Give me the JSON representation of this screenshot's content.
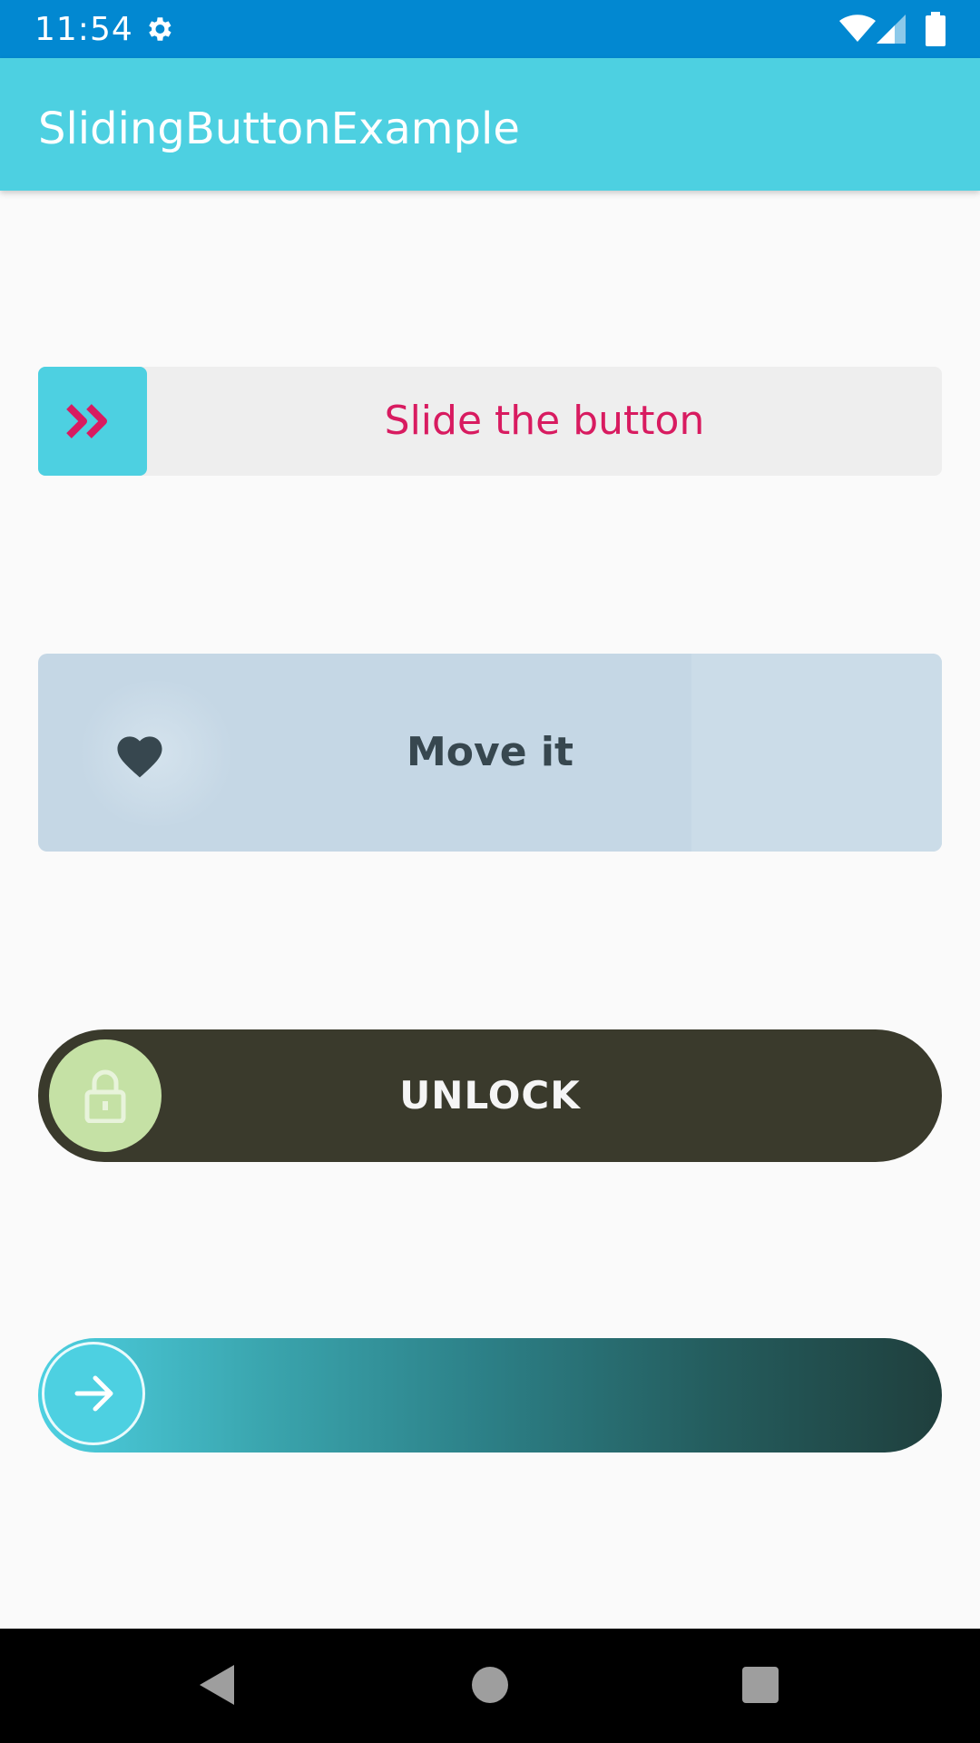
{
  "status_bar": {
    "time": "11:54",
    "color": "#0288d1",
    "icons": [
      "gear-icon",
      "wifi-icon",
      "signal-icon",
      "battery-icon"
    ]
  },
  "app_bar": {
    "title": "SlidingButtonExample",
    "color": "#4dd0e1"
  },
  "sliders": [
    {
      "label": "Slide the button",
      "icon": "double-chevron-right-icon",
      "track_color": "#eeeeee",
      "handle_color": "#4dd0e1",
      "text_color": "#d81b60"
    },
    {
      "label": "Move it",
      "icon": "heart-icon",
      "track_color": "#c5d7e5",
      "text_color": "#37474f"
    },
    {
      "label": "UNLOCK",
      "icon": "lock-icon",
      "track_color": "#3a3a2c",
      "handle_color": "#c5e1a5",
      "text_color": "#f5f5f5"
    },
    {
      "label": "",
      "icon": "arrow-right-icon",
      "gradient_start": "#4dd0e1",
      "gradient_end": "#1f3f3d",
      "handle_color": "#4dd0e1"
    }
  ],
  "nav_bar": {
    "buttons": [
      "back-icon",
      "home-icon",
      "recent-apps-icon"
    ]
  }
}
